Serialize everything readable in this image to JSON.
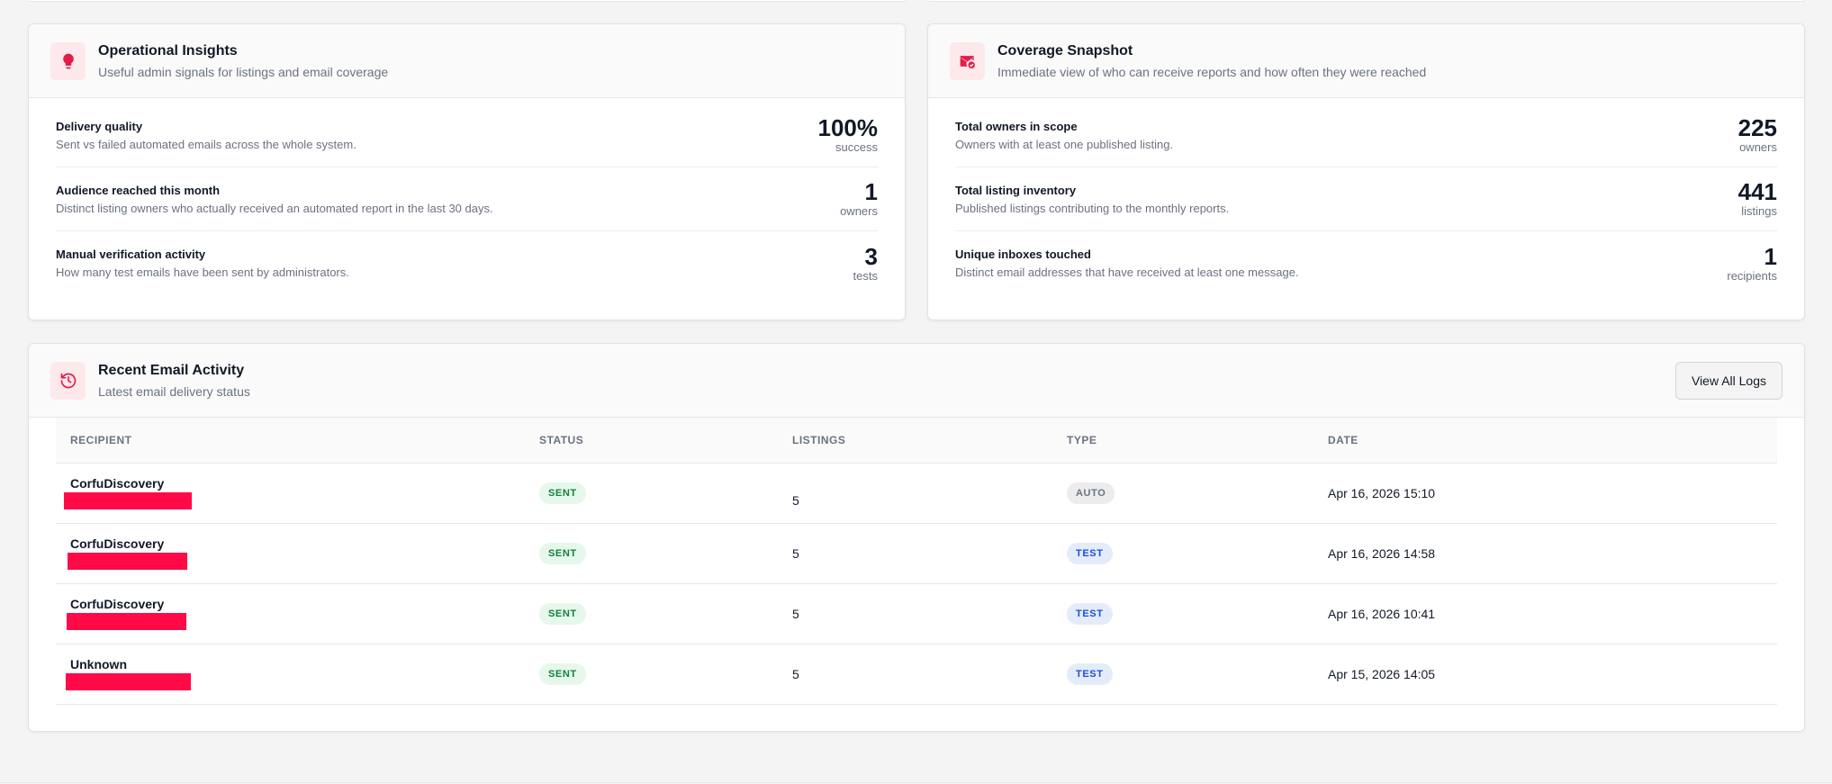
{
  "colors": {
    "accent": "#e11d48",
    "redaction": "#ff0a47",
    "sent": "#15803d",
    "test": "#1d4ed8"
  },
  "operational_insights": {
    "icon": "lightbulb-icon",
    "title": "Operational Insights",
    "subtitle": "Useful admin signals for listings and email coverage",
    "metrics": [
      {
        "title": "Delivery quality",
        "description": "Sent vs failed automated emails across the whole system.",
        "value": "100%",
        "unit": "success"
      },
      {
        "title": "Audience reached this month",
        "description": "Distinct listing owners who actually received an automated report in the last 30 days.",
        "value": "1",
        "unit": "owners"
      },
      {
        "title": "Manual verification activity",
        "description": "How many test emails have been sent by administrators.",
        "value": "3",
        "unit": "tests"
      }
    ]
  },
  "coverage_snapshot": {
    "icon": "mail-check-icon",
    "title": "Coverage Snapshot",
    "subtitle": "Immediate view of who can receive reports and how often they were reached",
    "metrics": [
      {
        "title": "Total owners in scope",
        "description": "Owners with at least one published listing.",
        "value": "225",
        "unit": "owners"
      },
      {
        "title": "Total listing inventory",
        "description": "Published listings contributing to the monthly reports.",
        "value": "441",
        "unit": "listings"
      },
      {
        "title": "Unique inboxes touched",
        "description": "Distinct email addresses that have received at least one message.",
        "value": "1",
        "unit": "recipients"
      }
    ]
  },
  "recent_activity": {
    "icon": "history-icon",
    "title": "Recent Email Activity",
    "subtitle": "Latest email delivery status",
    "view_all_label": "View All Logs",
    "columns": [
      "RECIPIENT",
      "STATUS",
      "LISTINGS",
      "TYPE",
      "DATE"
    ],
    "rows": [
      {
        "recipient": "CorfuDiscovery",
        "status": "SENT",
        "listings": "5",
        "type": "AUTO",
        "date": "Apr 16, 2026 15:10"
      },
      {
        "recipient": "CorfuDiscovery",
        "status": "SENT",
        "listings": "5",
        "type": "TEST",
        "date": "Apr 16, 2026 14:58"
      },
      {
        "recipient": "CorfuDiscovery",
        "status": "SENT",
        "listings": "5",
        "type": "TEST",
        "date": "Apr 16, 2026 10:41"
      },
      {
        "recipient": "Unknown",
        "status": "SENT",
        "listings": "5",
        "type": "TEST",
        "date": "Apr 15, 2026 14:05"
      }
    ]
  }
}
